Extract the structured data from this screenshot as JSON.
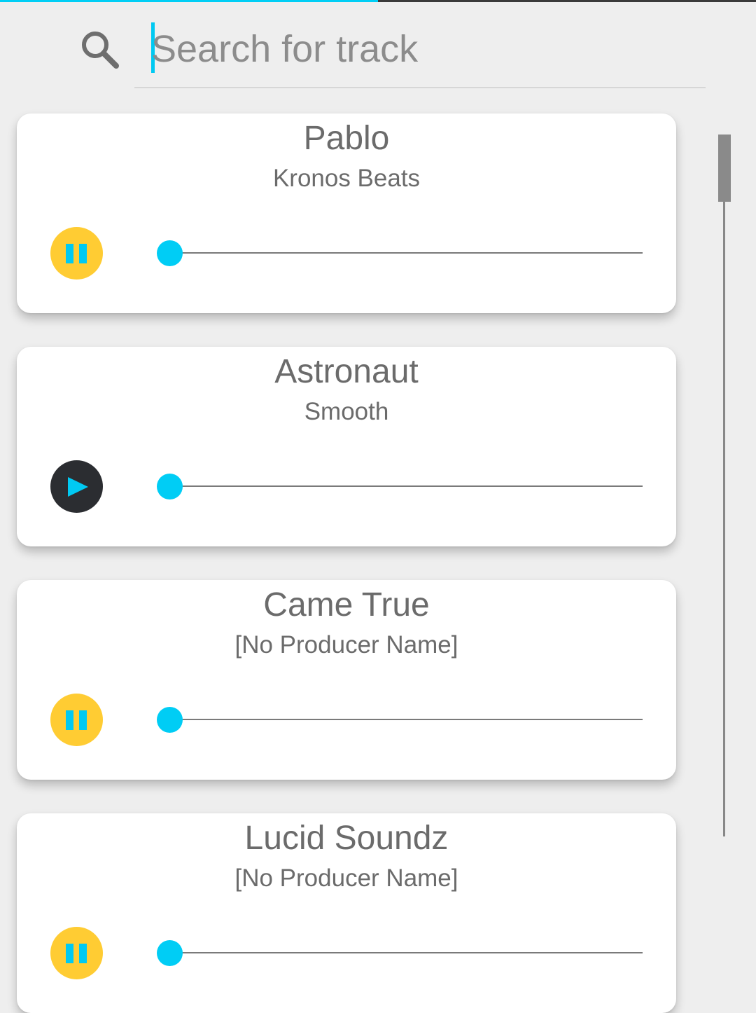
{
  "search": {
    "placeholder": "Search for track",
    "value": ""
  },
  "loading_progress": 0.5,
  "scroll_position": 0.0,
  "colors": {
    "accent": "#00cdf5",
    "pause_button": "#ffcc33",
    "play_button": "#2b2d31",
    "card_background": "#ffffff",
    "page_background": "#eeeeee"
  },
  "tracks": [
    {
      "title": "Pablo",
      "producer": "Kronos Beats",
      "state": "playing",
      "button_icon": "pause-icon",
      "progress": 0.0
    },
    {
      "title": "Astronaut",
      "producer": "Smooth",
      "state": "stopped",
      "button_icon": "play-icon",
      "progress": 0.0
    },
    {
      "title": "Came True",
      "producer": "[No Producer Name]",
      "state": "playing",
      "button_icon": "pause-icon",
      "progress": 0.0
    },
    {
      "title": "Lucid Soundz",
      "producer": "[No Producer Name]",
      "state": "playing",
      "button_icon": "pause-icon",
      "progress": 0.0
    }
  ]
}
